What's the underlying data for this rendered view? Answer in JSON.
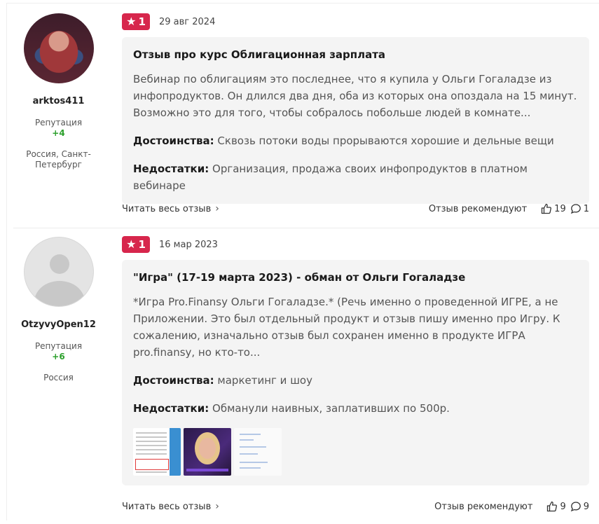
{
  "reviews": [
    {
      "author": {
        "name": "arktos411",
        "reputation_label": "Репутация",
        "reputation_value": "+4",
        "location": "Россия, Санкт-Петербург"
      },
      "rating": "1",
      "date": "29 авг 2024",
      "title": "Отзыв про курс Облигационная зарплата",
      "text": "Вебинар по облигациям это последнее, что я купила у Ольги Гогаладзе из инфопродуктов. Он длился два дня, оба из которых она опоздала на 15 минут. Возможно это для того, чтобы собралось побольше людей в комнате...",
      "pros_label": "Достоинства:",
      "pros": "Сквозь потоки воды прорываются хорошие и дельные вещи",
      "cons_label": "Недостатки:",
      "cons": "Организация, продажа своих инфопродуктов в платном вебинаре",
      "read_more": "Читать весь отзыв",
      "recommend_label": "Отзыв рекомендуют",
      "likes": "19",
      "comments": "1"
    },
    {
      "author": {
        "name": "OtzyvyOpen12",
        "reputation_label": "Репутация",
        "reputation_value": "+6",
        "location": "Россия"
      },
      "rating": "1",
      "date": "16 мар 2023",
      "title": "\"Игра\" (17-19 марта 2023) - обман от Ольги Гогаладзе",
      "text": "*Игра Pro.Finansy Ольги Гогаладзе.* (Речь именно о проведенной ИГРЕ, а не Приложении. Это был отдельный продукт и отзыв пишу именно про Игру. К сожалению, изначально отзыв был сохранен именно в продукте ИГРА pro.finansy, но кто-то...",
      "pros_label": "Достоинства:",
      "pros": "маркетинг и шоу",
      "cons_label": "Недостатки:",
      "cons": "Обманули наивных, заплативших по 500р.",
      "read_more": "Читать весь отзыв",
      "recommend_label": "Отзыв рекомендуют",
      "likes": "9",
      "comments": "9"
    }
  ],
  "icons": {
    "rating_star": "star-icon",
    "like": "thumbs-up-icon",
    "comment": "comment-icon",
    "chevron": "chevron-right-icon"
  },
  "colors": {
    "badge": "#d7264c",
    "reputation": "#2ca02c",
    "card_bg": "#f4f4f4"
  }
}
